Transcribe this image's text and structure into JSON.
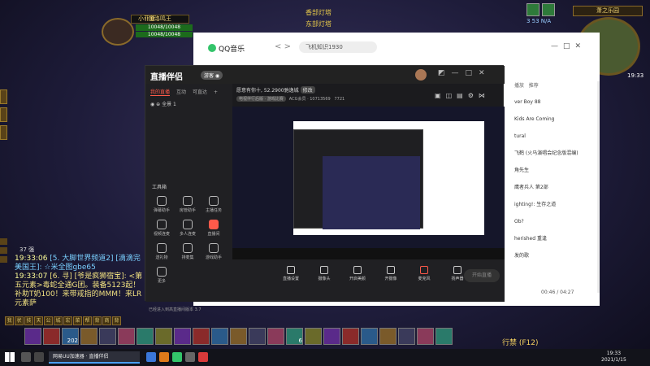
{
  "game": {
    "target_name": "小菲菲",
    "player_name": "加洛鸣王",
    "hp_text": "10048/10048",
    "mp_text": "10048/10048",
    "quest_lines": [
      "香部灯塔",
      "东部灯塔"
    ],
    "zone_name": "萧之乐园",
    "minimap_coords": "19:33",
    "buff_numbers": "3 53   N/A",
    "chat_header": "37 强",
    "chat_lines": [
      {
        "ts": "19:33:06",
        "text": "[5. 大脚世界频道2] [滴滴完美国王]: ☆米全图gbe65"
      },
      {
        "ts": "19:33:07",
        "text": "[6. 寻] [爷是疯狮宿宝]: <第五元素>毒蛇全通G团。装备5123起！补助T奶100！来带戒指的MMM！来LR 元素萨"
      }
    ],
    "bag_keys": [
      "我",
      "状",
      "技",
      "天",
      "公",
      "城",
      "宏",
      "菜",
      "帮",
      "背",
      "商",
      "背"
    ],
    "action_keys": [
      "",
      "",
      "202",
      "",
      "",
      "",
      "",
      "",
      "",
      "",
      "",
      "",
      "",
      "",
      "6",
      "",
      "",
      "",
      "",
      "",
      "",
      "",
      ""
    ],
    "f12_label": "行禁 (F12)"
  },
  "qq_music": {
    "app_name": "QQ音乐",
    "nav_icons": [
      "<",
      ">"
    ],
    "search_text": "飞机知识1930",
    "window_controls": [
      "—",
      "□",
      "✕"
    ],
    "sidebar_tabs": [
      "播放",
      "推荐"
    ],
    "items": [
      "",
      "ver Boy 88",
      "",
      "Kids Are Coming",
      "",
      "tural",
      "",
      "飞鹤 (火马演唱会纪念版混编)",
      "",
      "角先生",
      "",
      "鹰者兵人 第2部",
      "",
      "ighting!: 生存之道",
      "",
      "Ob?",
      "",
      "herished 重逢",
      "",
      "发的歌"
    ],
    "time": "00:46 / 04:27"
  },
  "stream_app": {
    "logo": "直播伴侣",
    "badge": "游客 ◉",
    "window_controls": [
      "◩",
      "—",
      "□",
      "✕"
    ],
    "tabs": [
      "我的直播",
      "互动",
      "可直达",
      "+"
    ],
    "scene": "全景 1",
    "tools_label": "工具箱",
    "tools": [
      {
        "label": "弹幕助手",
        "red": false
      },
      {
        "label": "房管助手",
        "red": false
      },
      {
        "label": "主播任务",
        "red": false
      },
      {
        "label": "视频连麦",
        "red": false
      },
      {
        "label": "多人连麦",
        "red": false
      },
      {
        "label": "直播间",
        "red": true
      },
      {
        "label": "送礼物",
        "red": false
      },
      {
        "label": "排麦集",
        "red": false
      },
      {
        "label": "游戏助手",
        "red": false
      },
      {
        "label": "更多",
        "red": false
      }
    ],
    "status_text": "已经进入到高直播间版本 3.7",
    "stream_title": "愿意有你十, 52.2900驰逸城",
    "stream_tag": "修改",
    "info_pills": [
      "电视伴行后版 · 游戏比赛",
      "ACG会员 · 10713569",
      "7721"
    ],
    "controls": [
      {
        "label": "直播设置",
        "mic": false
      },
      {
        "label": "摄像头",
        "mic": false
      },
      {
        "label": "开启美颜",
        "mic": false
      },
      {
        "label": "开摄像",
        "mic": false
      },
      {
        "label": "麦克风",
        "mic": true
      },
      {
        "label": "扬声器",
        "mic": false
      }
    ],
    "go_live": "开始直播"
  },
  "taskbar": {
    "active_window": "网易UU加速器 · 直播伴侣",
    "clock_time": "19:33",
    "clock_date": "2021/1/15"
  },
  "colors": {
    "stream_accent": "#ff5a4a",
    "qq_green": "#33c46a",
    "wow_gold": "#f3d77a"
  }
}
